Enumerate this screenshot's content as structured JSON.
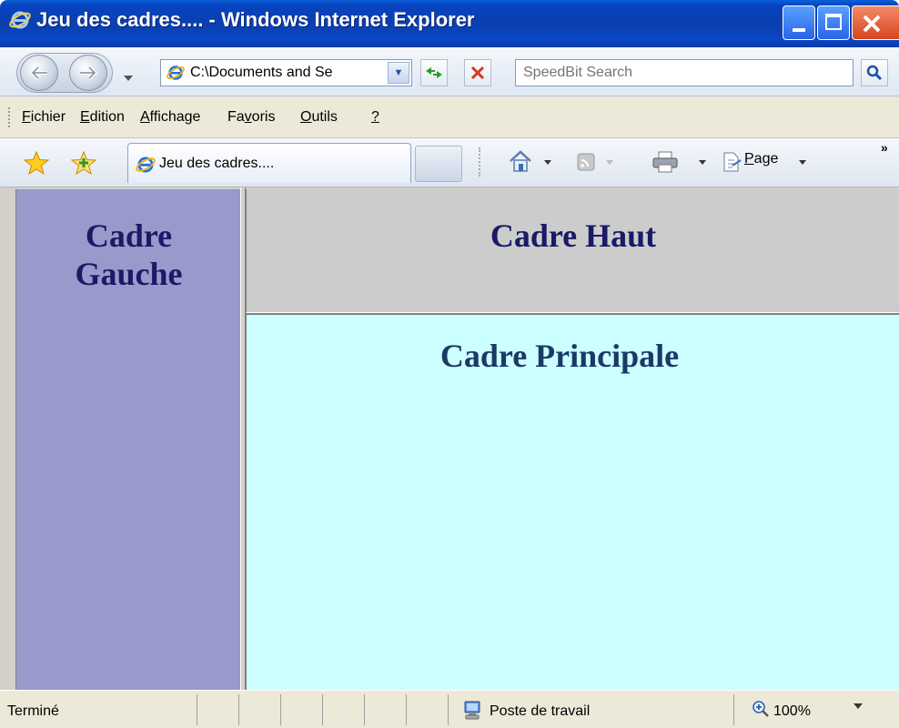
{
  "window": {
    "title": "Jeu des cadres.... - Windows Internet Explorer"
  },
  "address_bar": {
    "url": "C:\\Documents and Se",
    "search_placeholder": "SpeedBit Search"
  },
  "menu": {
    "items": [
      {
        "label": "Fichier",
        "accel": "F",
        "rest": "ichier"
      },
      {
        "label": "Edition",
        "accel": "E",
        "rest": "dition"
      },
      {
        "label": "Affichage",
        "accel": "A",
        "rest": "ffichage"
      },
      {
        "label": "Favoris",
        "pre": "Fa",
        "accel": "v",
        "rest": "oris"
      },
      {
        "label": "Outils",
        "accel": "O",
        "rest": "utils"
      },
      {
        "label": "?",
        "accel": "?",
        "rest": ""
      }
    ]
  },
  "tabs": {
    "active_label": "Jeu des cadres...."
  },
  "command_bar": {
    "page_label": "Page",
    "page_accel": "P",
    "page_rest": "age",
    "chevron": "»"
  },
  "frames": {
    "left_line1": "Cadre",
    "left_line2": "Gauche",
    "top_title": "Cadre Haut",
    "main_title": "Cadre Principale",
    "left_bg": "#9999cc",
    "top_bg": "#cccccc",
    "main_bg": "#ccffff"
  },
  "status_bar": {
    "status": "Terminé",
    "zone": "Poste de travail",
    "zoom": "100%"
  },
  "icons": {
    "ie": "ie-icon",
    "back": "back-arrow-icon",
    "forward": "forward-arrow-icon",
    "refresh": "refresh-icon",
    "stop": "stop-icon",
    "search": "search-icon",
    "favorites_star": "favorites-star-icon",
    "add_favorite": "add-favorite-icon",
    "home": "home-icon",
    "feeds": "feeds-icon",
    "print": "print-icon",
    "page": "page-icon",
    "computer": "computer-zone-icon",
    "zoom": "zoom-icon"
  }
}
